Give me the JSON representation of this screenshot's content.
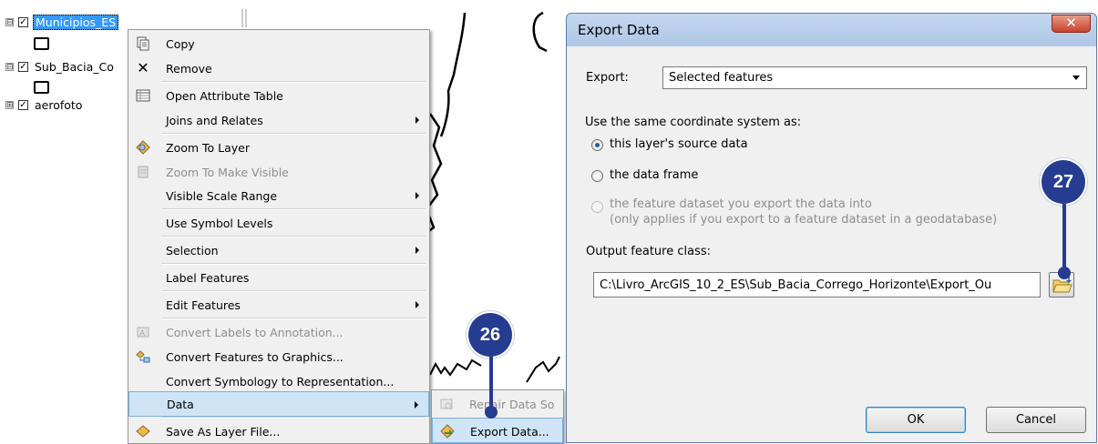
{
  "toc": {
    "layers": [
      {
        "name": "Municipios_ES",
        "expander": "⊟",
        "checked": true,
        "selected": true
      },
      {
        "name": "Sub_Bacia_Co",
        "expander": "⊟",
        "checked": true,
        "selected": false
      },
      {
        "name": "aerofoto",
        "expander": "⊞",
        "checked": true,
        "selected": false
      }
    ],
    "checkbox_mark": "✓"
  },
  "context_menu": {
    "items": [
      {
        "label": "Copy",
        "icon": "copy-icon",
        "disabled": false,
        "submenu": false
      },
      {
        "label": "Remove",
        "icon": "remove-icon",
        "disabled": false,
        "submenu": false
      },
      {
        "label": "Open Attribute Table",
        "icon": "attribute-table-icon",
        "disabled": false,
        "submenu": false
      },
      {
        "label": "Joins and Relates",
        "icon": "",
        "disabled": false,
        "submenu": true
      },
      {
        "label": "Zoom To Layer",
        "icon": "zoom-to-layer-icon",
        "disabled": false,
        "submenu": false
      },
      {
        "label": "Zoom To Make Visible",
        "icon": "zoom-to-make-visible-icon",
        "disabled": true,
        "submenu": false
      },
      {
        "label": "Visible Scale Range",
        "icon": "",
        "disabled": false,
        "submenu": true
      },
      {
        "label": "Use Symbol Levels",
        "icon": "",
        "disabled": false,
        "submenu": false
      },
      {
        "label": "Selection",
        "icon": "",
        "disabled": false,
        "submenu": true
      },
      {
        "label": "Label Features",
        "icon": "",
        "disabled": false,
        "submenu": false
      },
      {
        "label": "Edit Features",
        "icon": "",
        "disabled": false,
        "submenu": true
      },
      {
        "label": "Convert Labels to Annotation...",
        "icon": "convert-labels-icon",
        "disabled": true,
        "submenu": false
      },
      {
        "label": "Convert Features to Graphics...",
        "icon": "convert-features-icon",
        "disabled": false,
        "submenu": false
      },
      {
        "label": "Convert Symbology to Representation...",
        "icon": "",
        "disabled": false,
        "submenu": false
      },
      {
        "label": "Data",
        "icon": "",
        "disabled": false,
        "submenu": true,
        "highlight": true
      },
      {
        "label": "Save As Layer File...",
        "icon": "save-layer-file-icon",
        "disabled": false,
        "submenu": false
      }
    ]
  },
  "submenu": {
    "items": [
      {
        "label": "Repair Data So",
        "disabled": true
      },
      {
        "label": "Export Data...",
        "disabled": false,
        "highlight": true
      }
    ]
  },
  "callouts": {
    "first": "26",
    "second": "27"
  },
  "dialog": {
    "title": "Export Data",
    "close_glyph": "✕",
    "export_label": "Export:",
    "export_value": "Selected features",
    "coord_heading": "Use the same coordinate system as:",
    "radios": [
      {
        "label": "this layer's source data",
        "checked": true,
        "disabled": false
      },
      {
        "label": "the data frame",
        "checked": false,
        "disabled": false
      },
      {
        "label": "the feature dataset you export the data into",
        "checked": false,
        "disabled": true
      }
    ],
    "radio_note": "(only applies if you export to a feature dataset in a geodatabase)",
    "output_label": "Output feature class:",
    "output_value": "C:\\Livro_ArcGIS_10_2_ES\\Sub_Bacia_Corrego_Horizonte\\Export_Ou",
    "ok_label": "OK",
    "cancel_label": "Cancel"
  },
  "colors": {
    "callout": "#253c91",
    "selection": "#3399ff",
    "highlight": "#cfe4f7"
  }
}
